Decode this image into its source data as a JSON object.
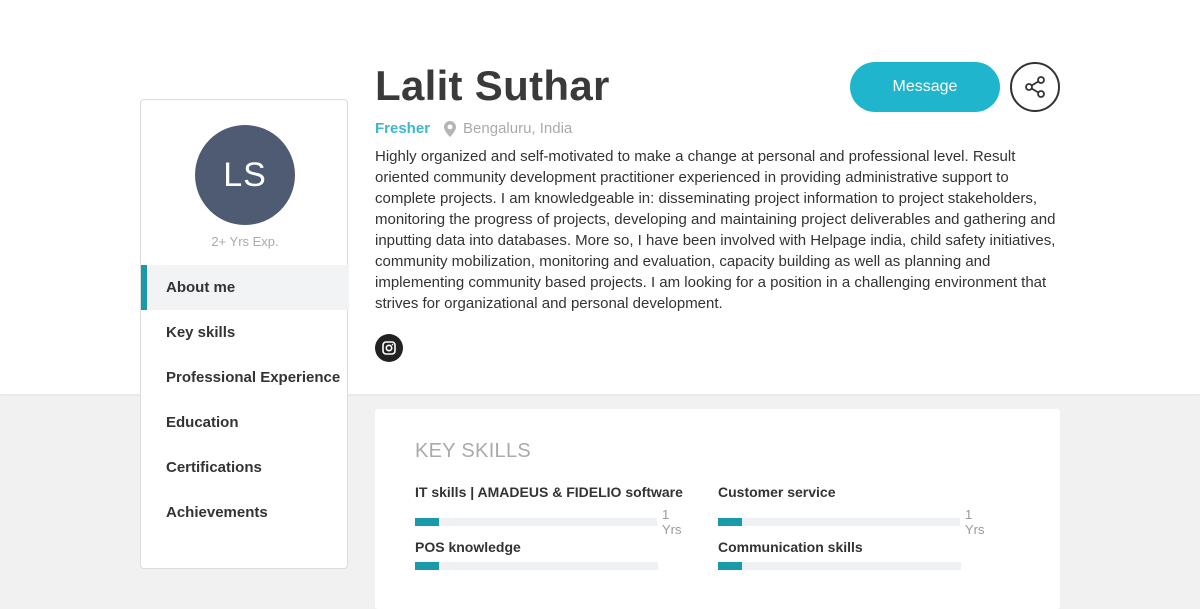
{
  "profile": {
    "initials": "LS",
    "experience": "2+ Yrs Exp.",
    "name": "Lalit Suthar",
    "status": "Fresher",
    "location": "Bengaluru, India",
    "bio": "Highly organized and self-motivated to make a change at personal and professional level. Result oriented community development practitioner experienced in providing administrative support to complete projects. I am knowledgeable in: disseminating project information to project stakeholders, monitoring the progress of projects, developing and maintaining project deliverables and gathering and inputting data into databases. More so, I have been involved with Helpage india, child safety initiatives, community mobilization, monitoring and evaluation, capacity building as well as planning and implementing community based projects. I am looking for a position in a challenging environment that strives for organizational and personal development."
  },
  "actions": {
    "message_label": "Message",
    "share_icon": "share-icon",
    "instagram_icon": "instagram-icon"
  },
  "sidebar": {
    "items": [
      {
        "label": "About me",
        "active": true
      },
      {
        "label": "Key skills",
        "active": false
      },
      {
        "label": "Professional Experience",
        "active": false
      },
      {
        "label": "Education",
        "active": false
      },
      {
        "label": "Certifications",
        "active": false
      },
      {
        "label": "Achievements",
        "active": false
      }
    ]
  },
  "skills": {
    "title": "KEY SKILLS",
    "items": [
      {
        "name": "IT skills | AMADEUS & FIDELIO software",
        "years": "1 Yrs",
        "level": 0.1
      },
      {
        "name": "Customer service",
        "years": "1 Yrs",
        "level": 0.1
      },
      {
        "name": "POS knowledge",
        "years": "",
        "level": 0.1
      },
      {
        "name": "Communication skills",
        "years": "",
        "level": 0.1
      }
    ]
  },
  "colors": {
    "accent": "#1fb5cc",
    "accent_dark": "#1a9aa8",
    "avatar_bg": "#4f5a73"
  }
}
